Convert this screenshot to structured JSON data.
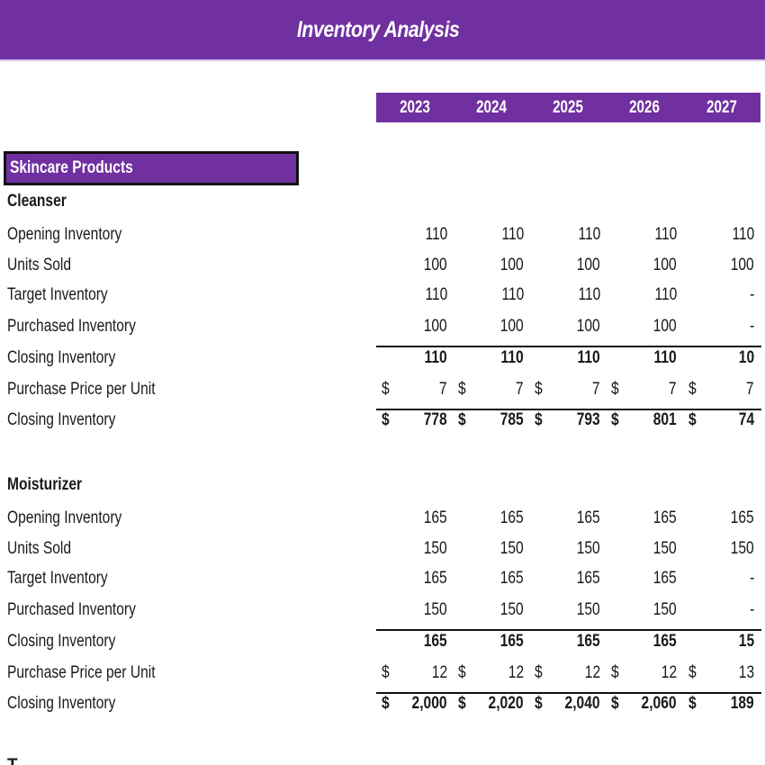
{
  "title": "Inventory Analysis",
  "years": [
    "2023",
    "2024",
    "2025",
    "2026",
    "2027"
  ],
  "section": "Skincare Products",
  "currency_symbol": "$",
  "colors": {
    "header_purple": "#7030a0",
    "header_text": "#ffffff",
    "border": "#111111"
  },
  "products": [
    {
      "name": "Cleanser",
      "rows": [
        {
          "label": "Opening Inventory",
          "values": [
            "110",
            "110",
            "110",
            "110",
            "110"
          ]
        },
        {
          "label": "Units Sold",
          "values": [
            "100",
            "100",
            "100",
            "100",
            "100"
          ]
        },
        {
          "label": "Target Inventory",
          "values": [
            "110",
            "110",
            "110",
            "110",
            "-"
          ]
        },
        {
          "label": "Purchased Inventory",
          "values": [
            "100",
            "100",
            "100",
            "100",
            "-"
          ]
        },
        {
          "label": "Closing Inventory",
          "values": [
            "110",
            "110",
            "110",
            "110",
            "10"
          ]
        },
        {
          "label": "Purchase Price per Unit",
          "values": [
            "7",
            "7",
            "7",
            "7",
            "7"
          ]
        },
        {
          "label": "Closing Inventory",
          "values": [
            "778",
            "785",
            "793",
            "801",
            "74"
          ]
        }
      ]
    },
    {
      "name": "Moisturizer",
      "rows": [
        {
          "label": "Opening Inventory",
          "values": [
            "165",
            "165",
            "165",
            "165",
            "165"
          ]
        },
        {
          "label": "Units Sold",
          "values": [
            "150",
            "150",
            "150",
            "150",
            "150"
          ]
        },
        {
          "label": "Target Inventory",
          "values": [
            "165",
            "165",
            "165",
            "165",
            "-"
          ]
        },
        {
          "label": "Purchased Inventory",
          "values": [
            "150",
            "150",
            "150",
            "150",
            "-"
          ]
        },
        {
          "label": "Closing Inventory",
          "values": [
            "165",
            "165",
            "165",
            "165",
            "15"
          ]
        },
        {
          "label": "Purchase Price per Unit",
          "values": [
            "12",
            "12",
            "12",
            "12",
            "13"
          ]
        },
        {
          "label": "Closing Inventory",
          "values": [
            "2,000",
            "2,020",
            "2,040",
            "2,060",
            "189"
          ]
        }
      ]
    }
  ],
  "next_product_partial": "T"
}
